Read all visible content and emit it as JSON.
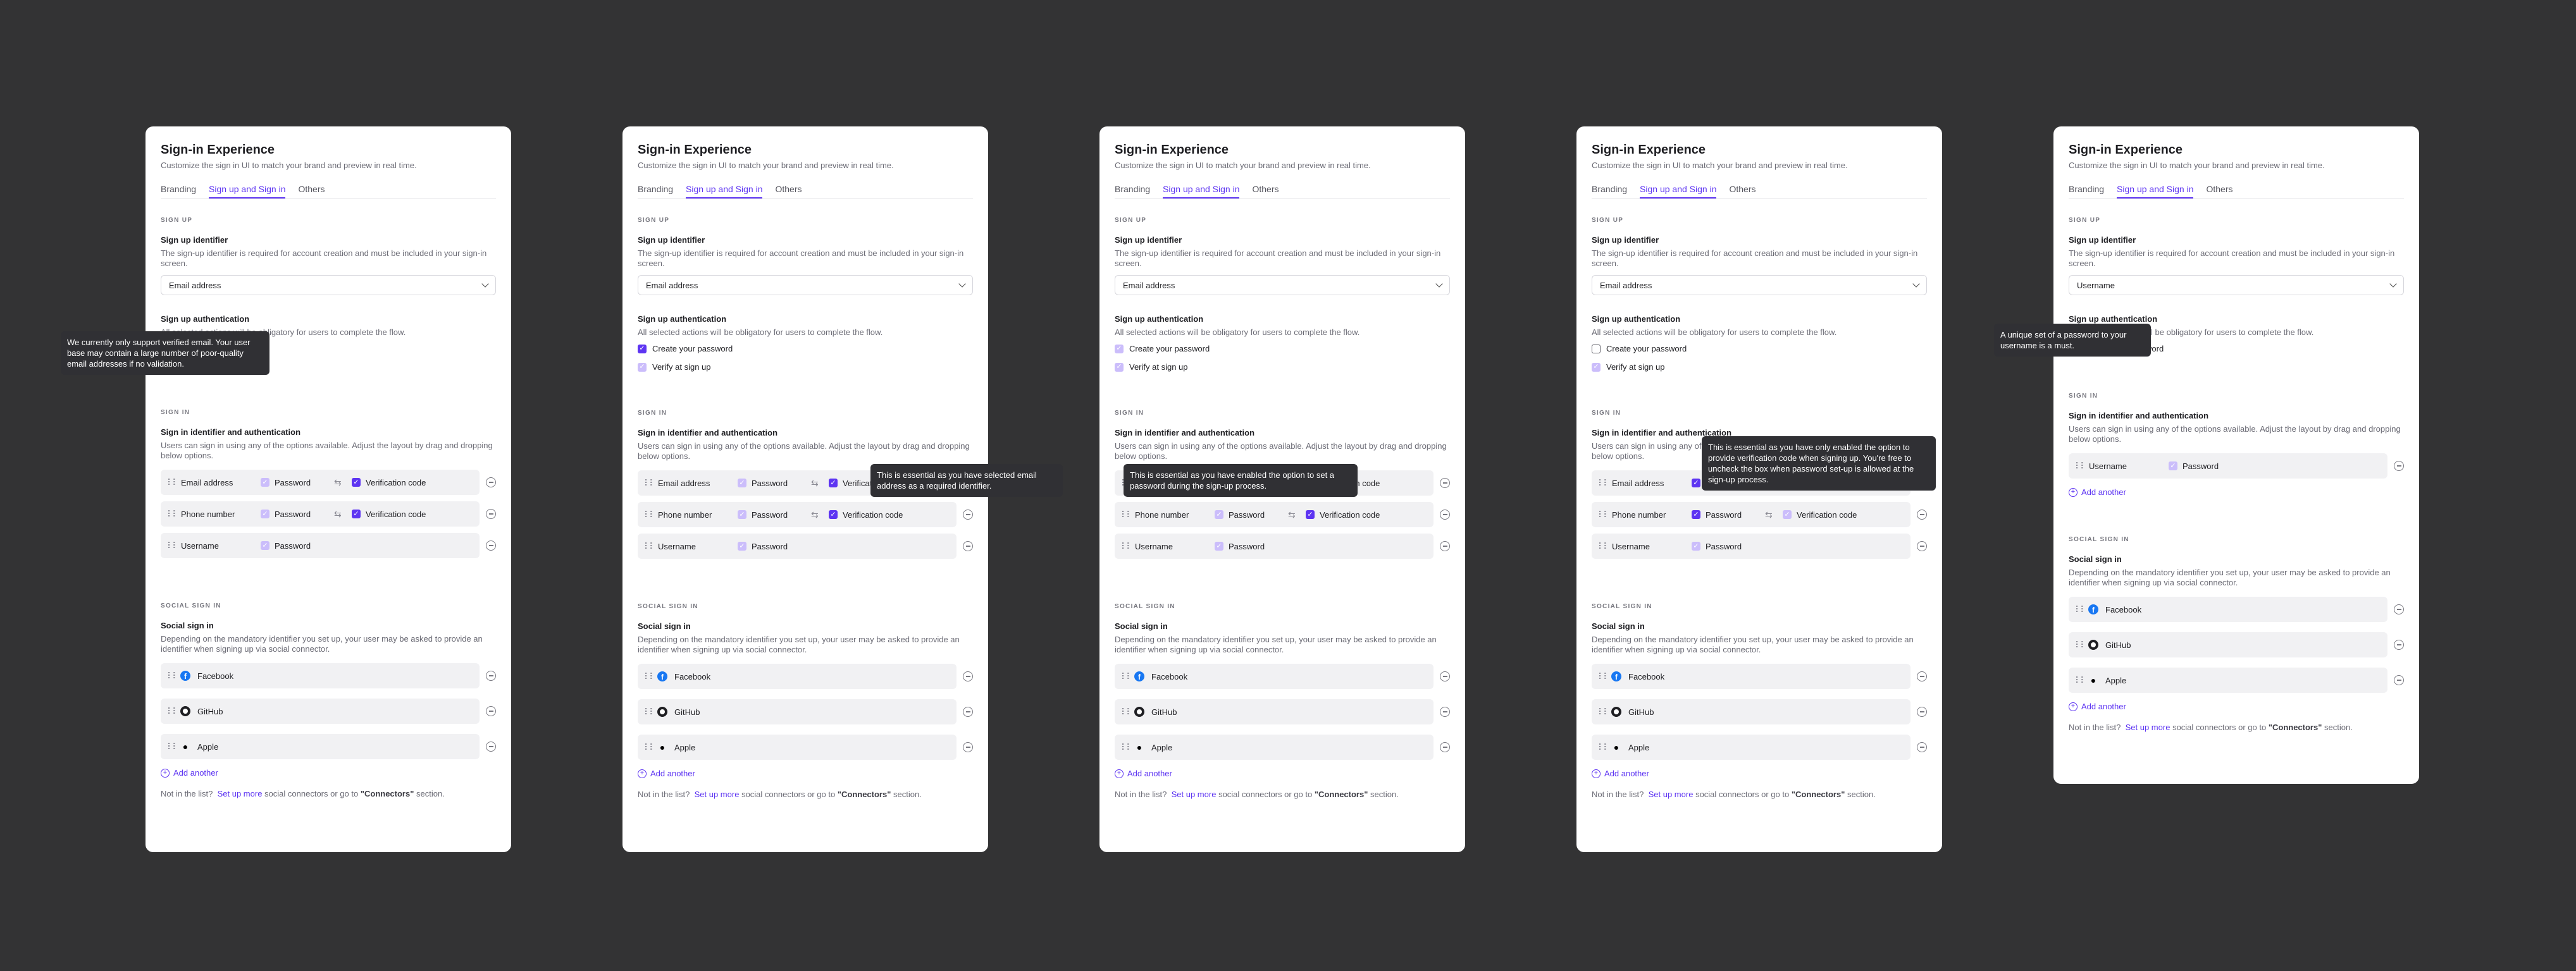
{
  "common": {
    "title": "Sign-in Experience",
    "subtitle": "Customize the sign in UI to match your brand and preview in real time.",
    "tabs": [
      "Branding",
      "Sign up and Sign in",
      "Others"
    ],
    "signup_section": "SIGN UP",
    "signup_identifier_label": "Sign up identifier",
    "signup_identifier_desc": "The sign-up identifier is required for account creation and must be included in your sign-in screen.",
    "signup_auth_label": "Sign up authentication",
    "signup_auth_desc": "All selected actions will be obligatory for users to complete the flow.",
    "create_password": "Create your password",
    "verify_at_signup": "Verify at sign up",
    "signin_section": "SIGN IN",
    "signin_label": "Sign in identifier and authentication",
    "signin_desc": "Users can sign in using any of the options available. Adjust the layout by drag and dropping below options.",
    "password": "Password",
    "verification_code": "Verification code",
    "identifiers": [
      "Email address",
      "Phone number",
      "Username"
    ],
    "social_section": "SOCIAL SIGN IN",
    "social_label": "Social sign in",
    "social_desc": "Depending on the mandatory identifier you set up, your user may be asked to provide an identifier when signing up via social connector.",
    "connectors": [
      "Facebook",
      "GitHub",
      "Apple"
    ],
    "add_another": "Add another",
    "footer_prefix": "Not in the list?",
    "footer_link": "Set up more",
    "footer_middle": "social connectors or go to",
    "footer_bold": "\"Connectors\"",
    "footer_suffix": "section.",
    "colors": {
      "accent": "#5d34f2",
      "background": "#333334",
      "card": "#ffffff",
      "tooltip": "#303034"
    },
    "icons": [
      "chevron-down-icon",
      "drag-handle-icon",
      "swap-icon",
      "remove-icon",
      "facebook-icon",
      "github-icon",
      "apple-icon",
      "add-icon",
      "checkmark-icon"
    ]
  },
  "cards": [
    {
      "select_value": "Email address",
      "tooltip": "We currently only support verified email. Your user base may contain a large number of poor-quality email addresses if no validation."
    },
    {
      "select_value": "Email address",
      "tooltip": "This is essential as you have selected email address as a required identifier."
    },
    {
      "select_value": "Email address",
      "tooltip": "This is essential as you have enabled the option to set a password during the sign-up process."
    },
    {
      "select_value": "Email address",
      "tooltip": "This is essential as you have only enabled the option to provide verification code when signing up. You're free to uncheck the box when password set-up is allowed at the sign-up process."
    },
    {
      "select_value": "Username",
      "tooltip": "A unique set of a password to your username is a must."
    }
  ]
}
